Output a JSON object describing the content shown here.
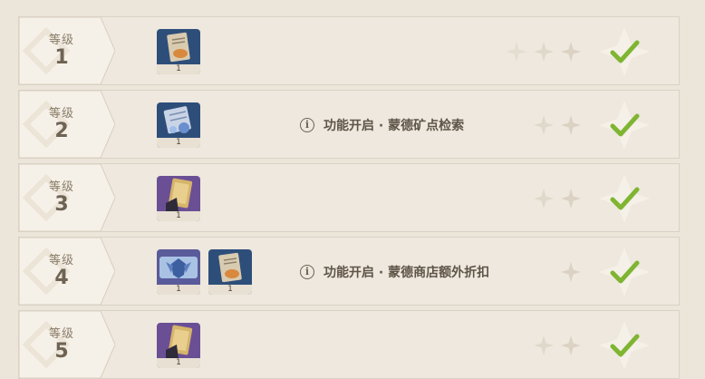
{
  "levels": [
    {
      "label": "等级",
      "number": "1",
      "feature": "",
      "rewards": [
        {
          "icon": "book-orange-icon",
          "count": "1",
          "bg": "#2e4e7a",
          "accent": "#d8893e"
        }
      ],
      "claimed": true
    },
    {
      "label": "等级",
      "number": "2",
      "feature": "功能开启 · 蒙德矿点检索",
      "rewards": [
        {
          "icon": "map-blue-icon",
          "count": "1",
          "bg": "#2e4e7a",
          "accent": "#6a8fcf"
        }
      ],
      "claimed": true
    },
    {
      "label": "等级",
      "number": "3",
      "feature": "",
      "rewards": [
        {
          "icon": "book-gold-icon",
          "count": "1",
          "bg": "#6a4f95",
          "accent": "#d6b46a"
        }
      ],
      "claimed": true
    },
    {
      "label": "等级",
      "number": "4",
      "feature": "功能开启 · 蒙德商店额外折扣",
      "rewards": [
        {
          "icon": "wings-blue-icon",
          "count": "1",
          "bg": "#5a5b9a",
          "accent": "#8fb4dd"
        },
        {
          "icon": "book-orange-icon",
          "count": "1",
          "bg": "#2e4e7a",
          "accent": "#d8893e"
        }
      ],
      "claimed": true
    },
    {
      "label": "等级",
      "number": "5",
      "feature": "",
      "rewards": [
        {
          "icon": "book-gold-icon",
          "count": "1",
          "bg": "#6a4f95",
          "accent": "#d6b46a"
        }
      ],
      "claimed": true
    }
  ],
  "colors": {
    "check": "#7fb531",
    "star": "#e2dbcf",
    "tab": "#f4efe6"
  }
}
